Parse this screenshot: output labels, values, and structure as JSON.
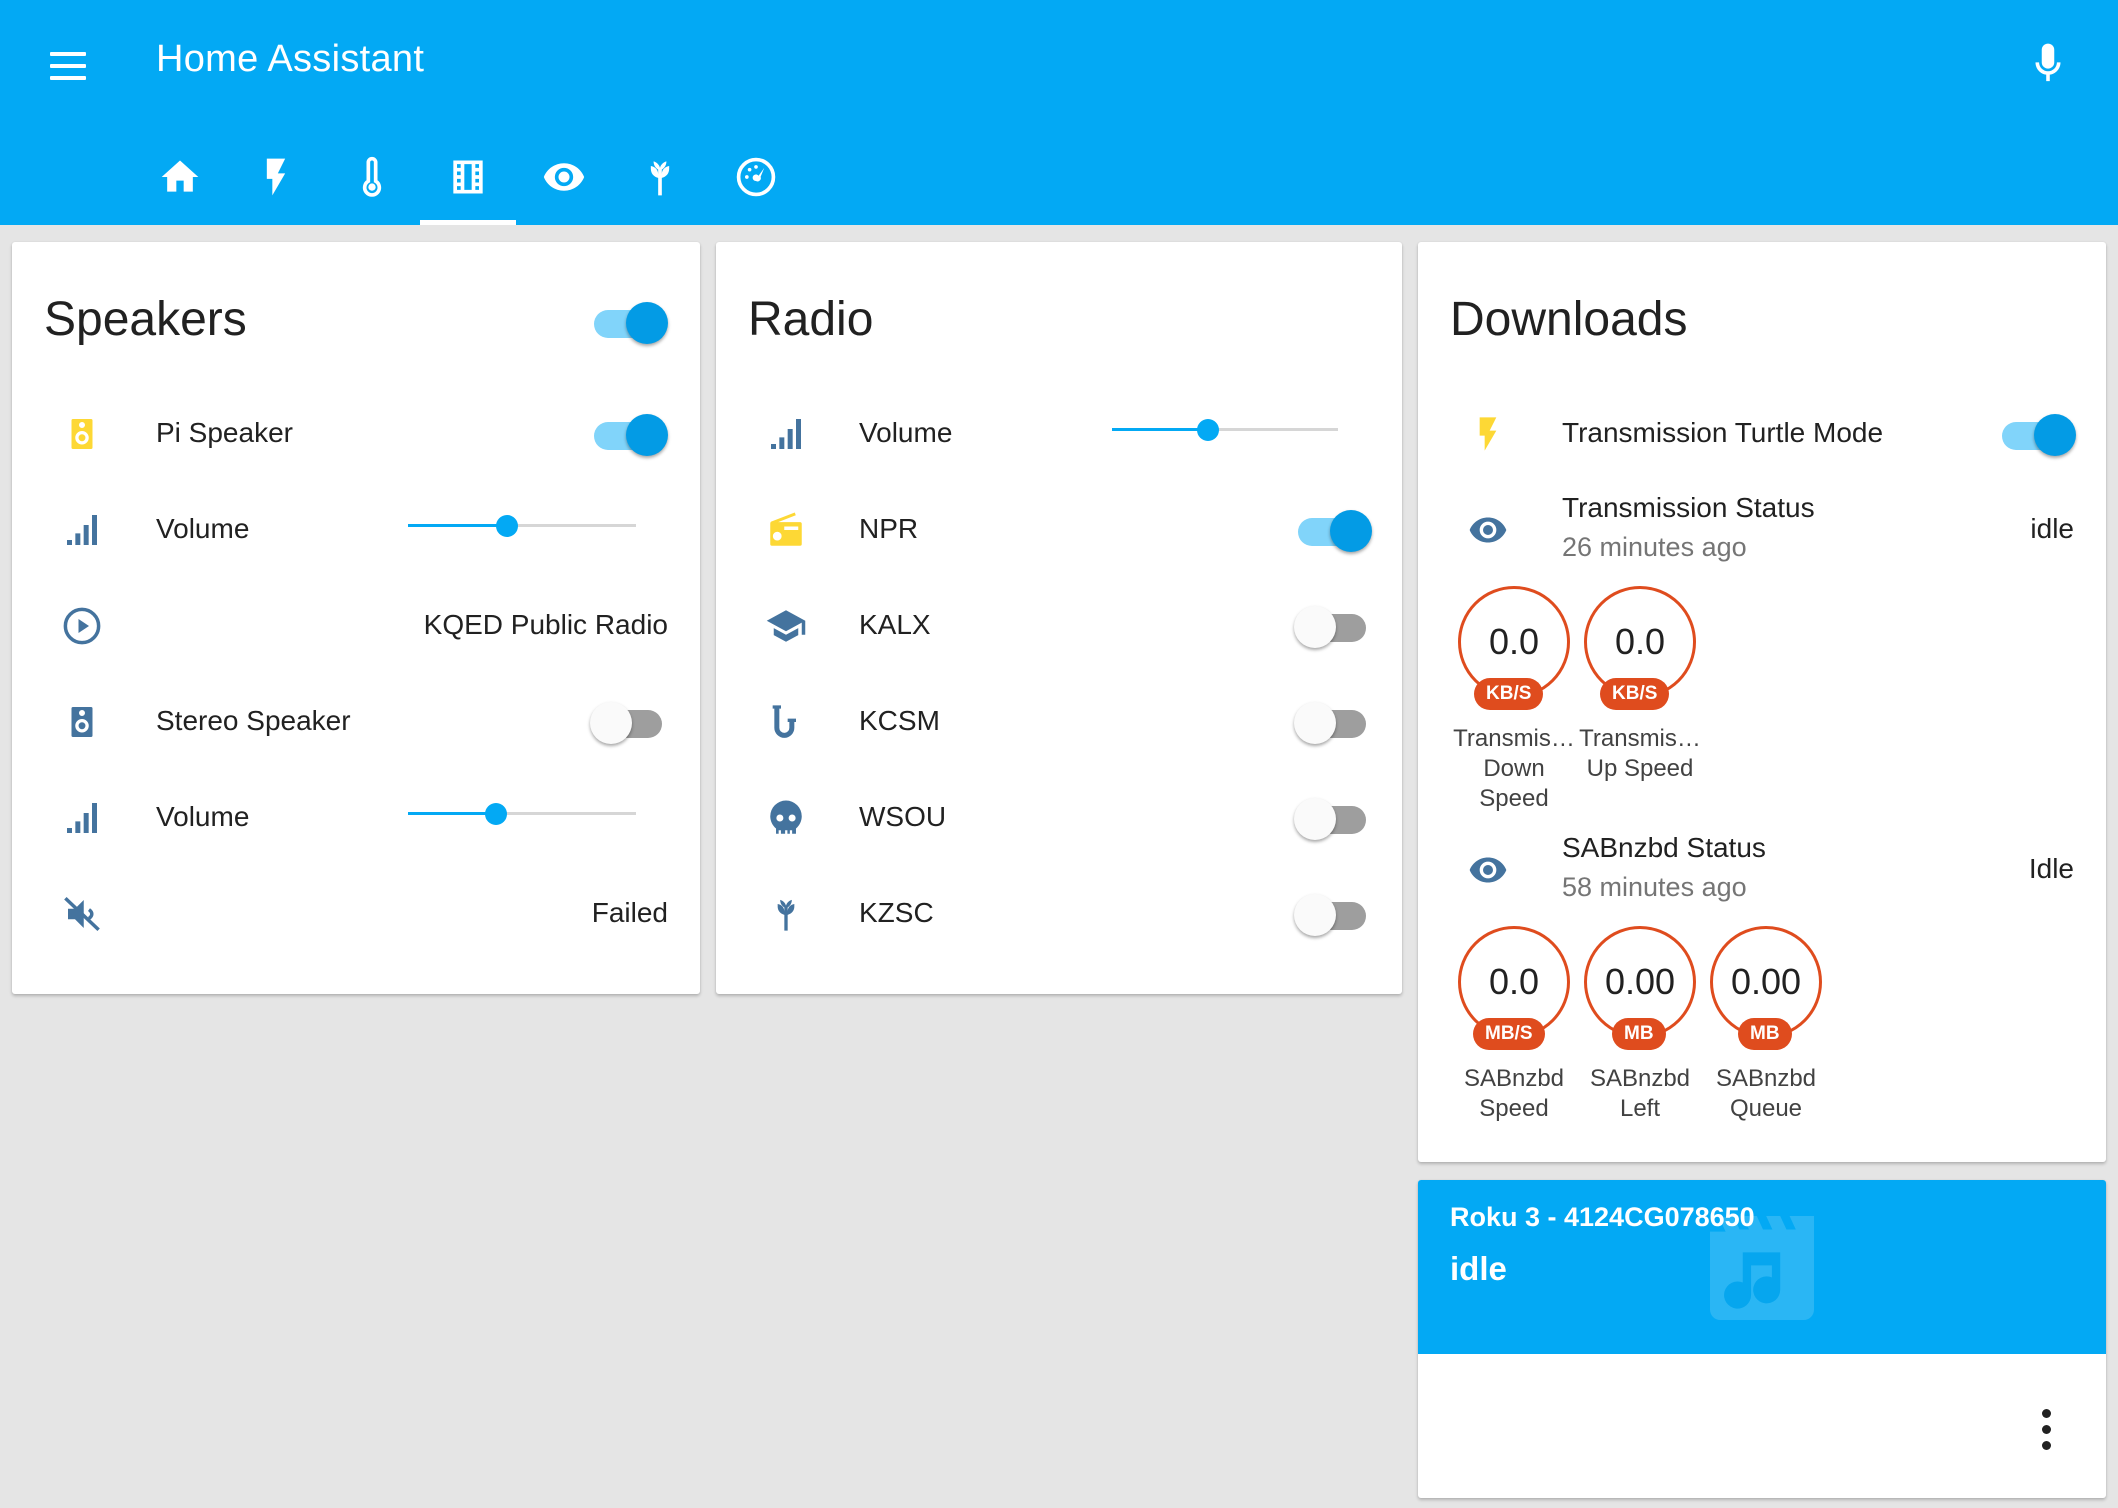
{
  "app": {
    "title": "Home Assistant"
  },
  "tabs": [
    {
      "icon": "home-icon"
    },
    {
      "icon": "flash-icon"
    },
    {
      "icon": "thermometer-icon"
    },
    {
      "icon": "film-icon",
      "active": true
    },
    {
      "icon": "eye-icon"
    },
    {
      "icon": "barley-icon"
    },
    {
      "icon": "gauge-icon"
    }
  ],
  "speakers": {
    "title": "Speakers",
    "master_on": true,
    "items": [
      {
        "label": "Pi Speaker",
        "icon": "speaker-icon",
        "on": true
      },
      {
        "label": "Volume",
        "icon": "signal-icon",
        "level": 0.43
      },
      {
        "value": "KQED Public Radio",
        "icon": "play-circle-icon"
      },
      {
        "label": "Stereo Speaker",
        "icon": "speaker-icon",
        "on": false
      },
      {
        "label": "Volume",
        "icon": "signal-icon",
        "level": 0.38
      },
      {
        "value": "Failed",
        "icon": "volume-off-icon"
      }
    ]
  },
  "radio": {
    "title": "Radio",
    "items": [
      {
        "label": "Volume",
        "icon": "signal-icon",
        "level": 0.43
      },
      {
        "label": "NPR",
        "icon": "radio-icon",
        "on": true
      },
      {
        "label": "KALX",
        "icon": "school-icon",
        "on": false
      },
      {
        "label": "KCSM",
        "icon": "saxophone-icon",
        "on": false
      },
      {
        "label": "WSOU",
        "icon": "skull-icon",
        "on": false
      },
      {
        "label": "KZSC",
        "icon": "barley-icon",
        "on": false
      }
    ]
  },
  "downloads": {
    "title": "Downloads",
    "turtle": {
      "label": "Transmission Turtle Mode",
      "icon": "flash-icon",
      "on": true
    },
    "transmission_status": {
      "label": "Transmission Status",
      "sub": "26 minutes ago",
      "value": "idle",
      "icon": "eye-icon"
    },
    "transmission_gauges": [
      {
        "value": "0.0",
        "unit": "KB/S",
        "label": "Transmis… Down Speed"
      },
      {
        "value": "0.0",
        "unit": "KB/S",
        "label": "Transmis… Up Speed"
      }
    ],
    "sab_status": {
      "label": "SABnzbd Status",
      "sub": "58 minutes ago",
      "value": "Idle",
      "icon": "eye-icon"
    },
    "sab_gauges": [
      {
        "value": "0.0",
        "unit": "MB/S",
        "label": "SABnzbd Speed"
      },
      {
        "value": "0.00",
        "unit": "MB",
        "label": "SABnzbd Left"
      },
      {
        "value": "0.00",
        "unit": "MB",
        "label": "SABnzbd Queue"
      }
    ]
  },
  "player": {
    "name": "Roku 3 - 4124CG078650",
    "state": "idle",
    "icon": "music-video-icon"
  },
  "colors": {
    "primary": "#03a9f4",
    "toggle_on": "#039be5",
    "gauge": "#df4c1e",
    "icon_blue": "#44739e",
    "icon_yellow": "#fdd835"
  }
}
